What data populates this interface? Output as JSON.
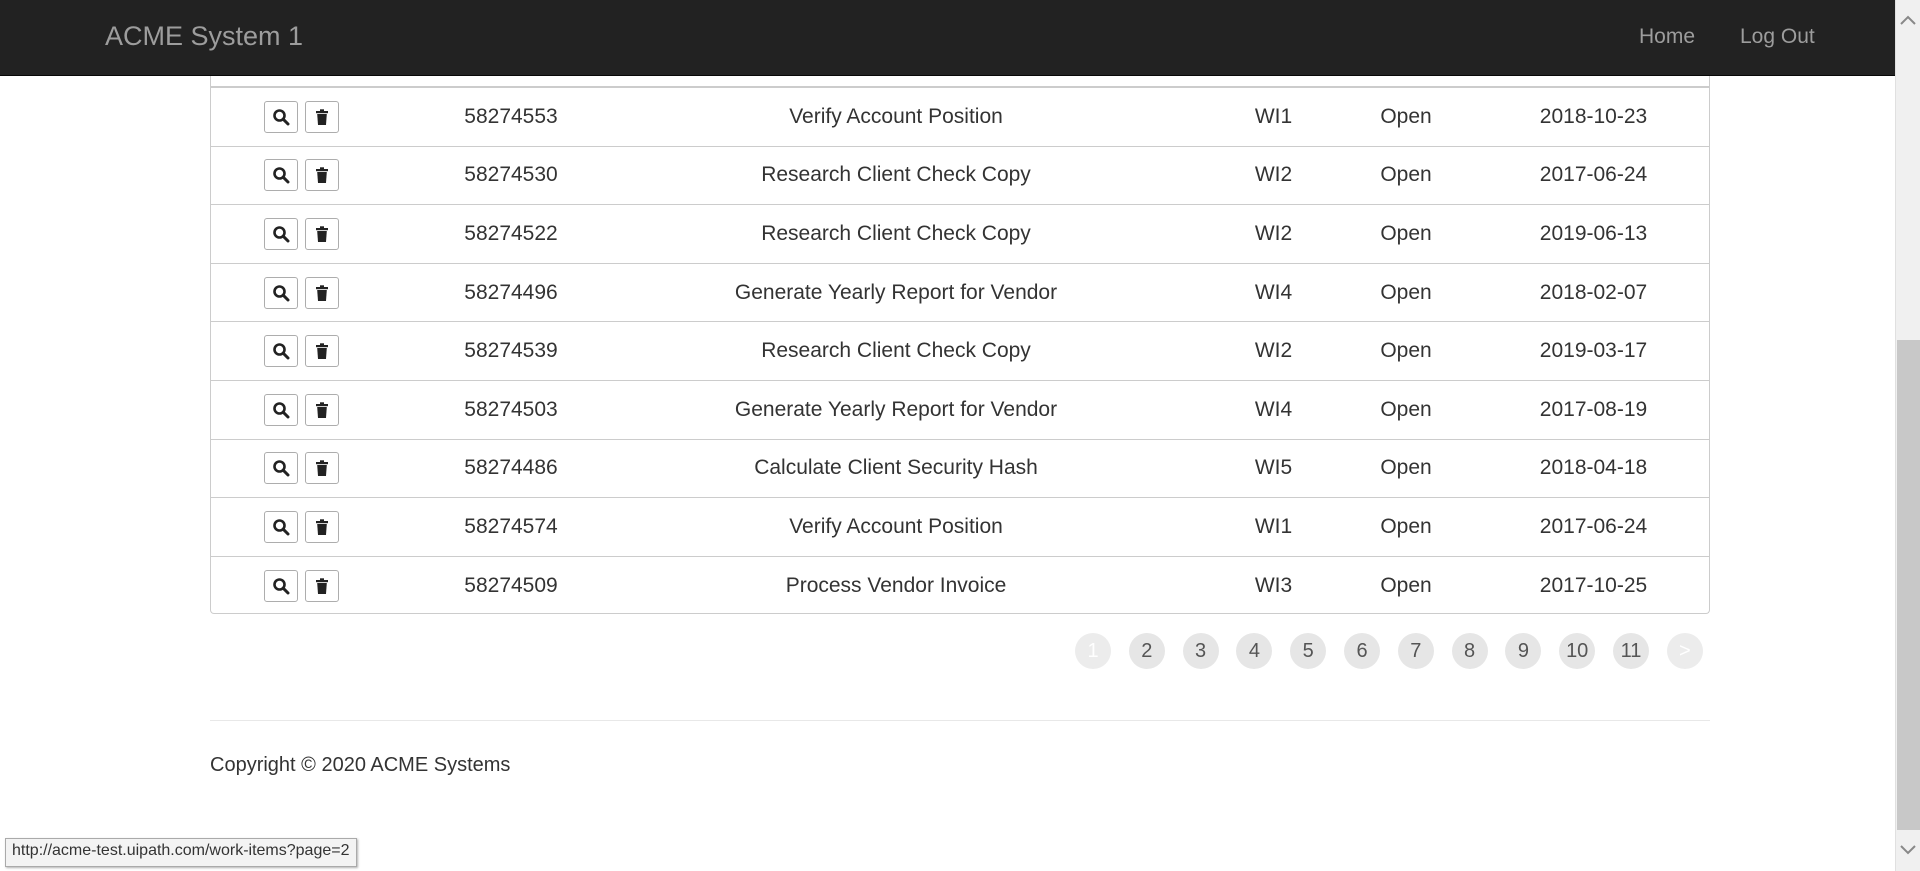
{
  "navbar": {
    "brand": "ACME System 1",
    "links": {
      "home": "Home",
      "logout": "Log Out"
    }
  },
  "table": {
    "rows": [
      {
        "id": "58274553",
        "description": "Verify Account Position",
        "type": "WI1",
        "status": "Open",
        "date": "2018-10-23"
      },
      {
        "id": "58274530",
        "description": "Research Client Check Copy",
        "type": "WI2",
        "status": "Open",
        "date": "2017-06-24"
      },
      {
        "id": "58274522",
        "description": "Research Client Check Copy",
        "type": "WI2",
        "status": "Open",
        "date": "2019-06-13"
      },
      {
        "id": "58274496",
        "description": "Generate Yearly Report for Vendor",
        "type": "WI4",
        "status": "Open",
        "date": "2018-02-07"
      },
      {
        "id": "58274539",
        "description": "Research Client Check Copy",
        "type": "WI2",
        "status": "Open",
        "date": "2019-03-17"
      },
      {
        "id": "58274503",
        "description": "Generate Yearly Report for Vendor",
        "type": "WI4",
        "status": "Open",
        "date": "2017-08-19"
      },
      {
        "id": "58274486",
        "description": "Calculate Client Security Hash",
        "type": "WI5",
        "status": "Open",
        "date": "2018-04-18"
      },
      {
        "id": "58274574",
        "description": "Verify Account Position",
        "type": "WI1",
        "status": "Open",
        "date": "2017-06-24"
      },
      {
        "id": "58274509",
        "description": "Process Vendor Invoice",
        "type": "WI3",
        "status": "Open",
        "date": "2017-10-25"
      }
    ],
    "action_icons": {
      "view": "search-icon",
      "delete": "trash-icon"
    }
  },
  "pagination": {
    "pages": [
      "1",
      "2",
      "3",
      "4",
      "5",
      "6",
      "7",
      "8",
      "9",
      "10",
      "11",
      ">"
    ],
    "current": "1"
  },
  "footer": {
    "copyright": "Copyright © 2020 ACME Systems"
  },
  "status_bar": {
    "url": "http://acme-test.uipath.com/work-items?page=2"
  },
  "colors": {
    "navbar_bg": "#222222",
    "nav_text": "#9d9d9d",
    "page_bubble": "#e6e6e6"
  }
}
